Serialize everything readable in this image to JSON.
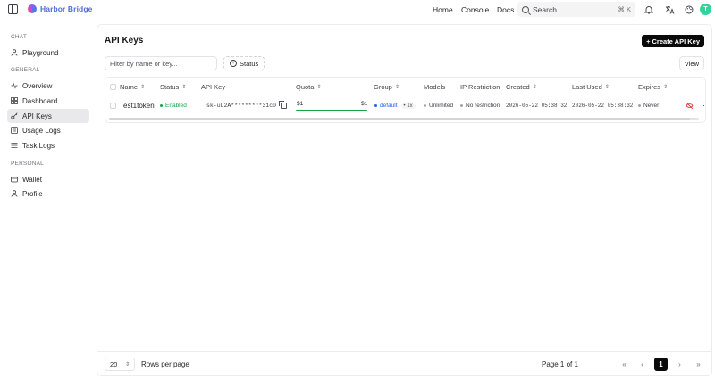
{
  "topbar": {
    "brand_name": "Harbor Bridge",
    "nav": [
      "Home",
      "Console",
      "Docs"
    ],
    "search_placeholder": "Search",
    "search_shortcut": "⌘ K",
    "avatar_initial": "T"
  },
  "sidebar": {
    "sections": [
      {
        "label": "CHAT",
        "items": [
          {
            "label": "Playground",
            "icon": "user-icon"
          }
        ]
      },
      {
        "label": "GENERAL",
        "items": [
          {
            "label": "Overview",
            "icon": "activity-icon"
          },
          {
            "label": "Dashboard",
            "icon": "grid-icon"
          },
          {
            "label": "API Keys",
            "icon": "key-icon",
            "active": true
          },
          {
            "label": "Usage Logs",
            "icon": "list-icon"
          },
          {
            "label": "Task Logs",
            "icon": "tasks-icon"
          }
        ]
      },
      {
        "label": "PERSONAL",
        "items": [
          {
            "label": "Wallet",
            "icon": "wallet-icon"
          },
          {
            "label": "Profile",
            "icon": "user-icon"
          }
        ]
      }
    ]
  },
  "main": {
    "title": "API Keys",
    "create_label": "Create API Key",
    "filter_placeholder": "Filter by name or key...",
    "status_filter_label": "Status",
    "view_label": "View",
    "columns": [
      "Name",
      "Status",
      "API Key",
      "Quota",
      "Group",
      "Models",
      "IP Restriction",
      "Created",
      "Last Used",
      "Expires"
    ],
    "rows": [
      {
        "name": "Test1token",
        "status": "Enabled",
        "api_key": "sk-uL2A*********31c0",
        "quota_used": "$1",
        "quota_total": "$1",
        "quota_fraction": 1.0,
        "group": "default",
        "group_multiplier": "1x",
        "models": "Unlimited",
        "ip_restriction": "No restriction",
        "created": "2026-05-22 05:38:32",
        "last_used": "2026-05-22 05:38:32",
        "expires": "Never"
      }
    ],
    "pagination": {
      "rows_per_page_value": "20",
      "rows_per_page_label": "Rows per page",
      "page_info": "Page 1 of 1",
      "current_page": "1"
    }
  },
  "colors": {
    "enabled": "#16a34a",
    "group": "#2563eb",
    "neutral_dot": "#a1a1aa",
    "avatar": "#34d399",
    "brand": "#4f6bd8"
  }
}
